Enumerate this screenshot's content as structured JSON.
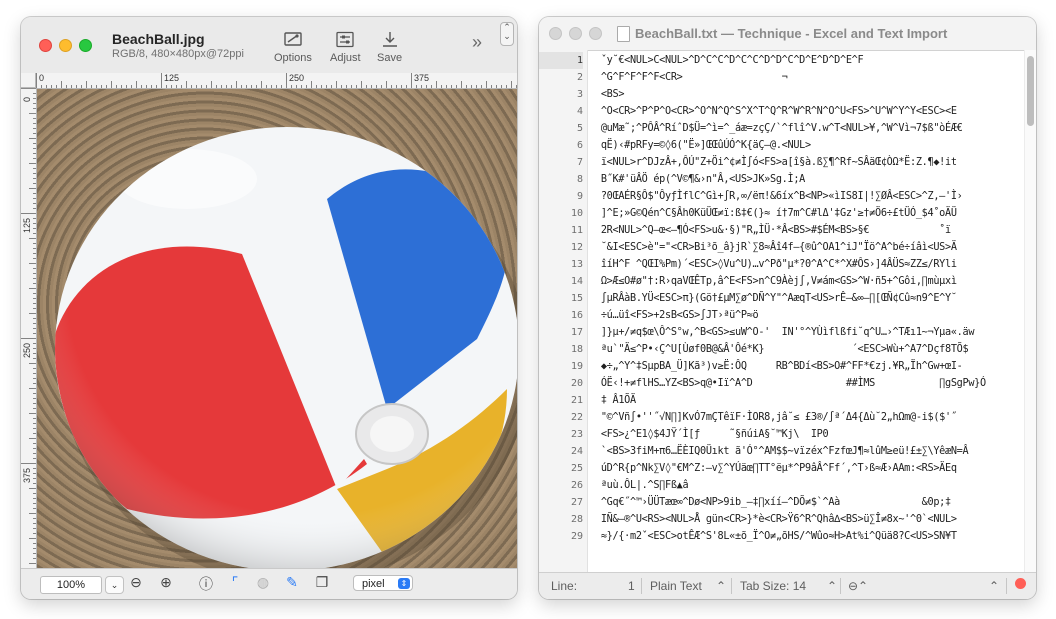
{
  "viewer": {
    "filename": "BeachBall.jpg",
    "fileinfo": "RGB/8, 480×480px@72ppi",
    "toolbar": {
      "options": "Options",
      "adjust": "Adjust",
      "save": "Save"
    },
    "ruler_top_labels": [
      "0",
      "125",
      "250",
      "375"
    ],
    "ruler_left_labels": [
      "0",
      "125",
      "250",
      "375"
    ],
    "zoom": "100%",
    "units": "pixel",
    "icons": [
      "zoom-out-icon",
      "zoom-in-icon",
      "info-icon",
      "crop-icon",
      "color-icon",
      "tool-icon",
      "copy-icon"
    ]
  },
  "editor": {
    "title": "BeachBall.txt — Technique - Excel and Text Import",
    "lines": [
      {
        "n": "1",
        "t": " ˇy˘€<NUL>C<NUL>^D^C^C^D^C^C^D^D^C^D^E^D^D^E^F"
      },
      {
        "n": "2",
        "t": " ^G^F^F^F^F<CR>                 ¬"
      },
      {
        "n": "3",
        "t": " <BS>"
      },
      {
        "n": "4",
        "t": " ^O<CR>^P^P^O<CR>^O^N^Q^S^X^T^Q^R^W^R^N^O^U<FS>^U^W^Y^Y<ESC><E"
      },
      {
        "n": "5",
        "t": " @uMæ˜;^PÔÂ^RíˆD$Ü=^ì=^_áæ=zçÇ/`^flî^V.w^T<NUL>¥,^W^Vì¬7$ß\"òÉÆ€"
      },
      {
        "n": "6",
        "t": " qË)‹#pRFy=©◊6(\"Ë»]ŒŒûÚÓ^K{äÇ—@.<NUL>"
      },
      {
        "n": "7",
        "t": " ï<NUL>r^DJzÂ+,ÔÚ\"Z+Öi^¢≠Ì∫ó<FS>a[î§à.ß∑¶^Rf~SÂäŒ¢ÒΩ*Ë:Z.¶◆!it"
      },
      {
        "n": "8",
        "t": " B˝K#'üÂÖ ép(^V©¶&›n\"Â,<US>JK»Sg.Ì;A"
      },
      {
        "n": "9",
        "t": " ?0ŒAÉR§Ô$\"ÔyƒÌflC^Gì+∫R,∞/ëπ!&6íx^B<NP>«ìIS8I|!∑ØÂ<ESC>^Z,–'Ì›"
      },
      {
        "n": "10",
        "t": " ]^E;»G©Qén^C§Âh0KüÜŒ≠ï:ß‡€(}≈ í†7m^C#lΔ'‡Gz'≥†≠Ö6÷£tÜÓ_$4˚oÄÜ"
      },
      {
        "n": "11",
        "t": " 2R<NUL>^Q—œ<—¶Ó<FS>u&·§)\"R„ÌÜ·*Â<BS>#$ÉM<BS>§€            ˚ï"
      },
      {
        "n": "12",
        "t": " ˘&I<ESC>è\"=\"<CR>Bi³õ_â}jR`∑8≈Âî4f—{®û^OA1^iJ\"Ïö^A^bé÷íâì<US>Ä"
      },
      {
        "n": "13",
        "t": " îíH^F ^QŒI%Pm)´<ESC>◊Vu^U)…v^Pð\"µ*?0^A^C*^X#ÔS›]4ÂÜS≈ZZ≤/RYli"
      },
      {
        "n": "14",
        "t": " Ω>Æ≤O#ø\"†:R›qaVŒÊTp,â^E<FS>n^C9Àèj∫,V≠ám<GS>^W·ñ5+^Gôi,∏mùµxì"
      },
      {
        "n": "15",
        "t": " ∫µRÂàB.YÜ<ESC>π}(Gö†£µM∑ø^DÑ^Y\"^AæqT<US>rÊ—&∞—∏[ŒÑ¢Cû≈n9^E^Y˘"
      },
      {
        "n": "16",
        "t": " ÷ú…üî<FS>+2sB<GS>∫JT›ªü^P≈ö"
      },
      {
        "n": "17",
        "t": " ]}µ+/≠q$œ\\Ô^S°w,^B<GS>≤uW^O-'  IN'°^YÙìflßfi˘q^U…›^TÆı1~¬Yµa«.äw"
      },
      {
        "n": "18",
        "t": " ªu`\"Ä≤^P•‹Ç^U[Ùøf0B@&Â'Ôé*K}               ´<ESC>Wù+^A7^Dçf8TÕ$"
      },
      {
        "n": "19",
        "t": " ◆÷„^Y^‡SµpBA_Ü]Kã³)v≥Ë:ÔQ     RB^BDí<BS>O#^FF*€zj.¥R„Ïh^Gw+œI-"
      },
      {
        "n": "20",
        "t": " ÓË‹!+≠flHS…YZ<BS>q@•Iï^A^D                ##ÌMS           ∏gSgPw}Ó"
      },
      {
        "n": "21",
        "t": " ‡ Â1ÕÄ"
      },
      {
        "n": "22",
        "t": " \"©^Vñ∫•''˝√N∏]KvÓ7mÇTêïF·ÌOR8,jâ˘≤ £3®/∫ª´Δ4{Δù˘2„hΩm@-i$($'˝"
      },
      {
        "n": "23",
        "t": " <FS>¿^E1◊$4JŸ´Ì[ƒ     ˜§ñúiA§˘™Kj\\  IP0"
      },
      {
        "n": "24",
        "t": " `<BS>3fiM+π6…ËÈIQ0Üıkt ã'Ó°^AM$$~vïzéx^FzfœJ¶≈lûM≥eü!£±∑\\YêæN=Â"
      },
      {
        "n": "25",
        "t": " úD^R{p^Nk∑V◊\"€M^Z:—v∑^YÚäœ∏TT°ëµ*^P9âÂ^Ff´,^T›ß≈Æ›AAm:<RS>ÄEq"
      },
      {
        "n": "26",
        "t": " ªuù.ÔL|.^S∏Fß▲â"
      },
      {
        "n": "27",
        "t": " ^Gq€˝^™›ÜÜTæœ∞^Dø<NP>9ib_—‡∏xíí–^DÕ≠$`^Aà              &0p;‡"
      },
      {
        "n": "28",
        "t": " IÑ&—®^U<RS><NUL>Å gün<CR>}*è<CR>Ÿ6^R^Qhâ∆<BS>ü∑Î≠8x~'^0`<NUL>"
      },
      {
        "n": "29",
        "t": " ≈}/{·m2ˇ<ESC>otÊÆ^S'8L«±õ_Ï^O≠„õHS/^Wûo≈H>At%i^Qüä8?C<US>SN¥T"
      }
    ],
    "status": {
      "line_label": "Line:",
      "line_value": "1",
      "syntax": "Plain Text",
      "tab_size": "Tab Size:  14"
    }
  }
}
